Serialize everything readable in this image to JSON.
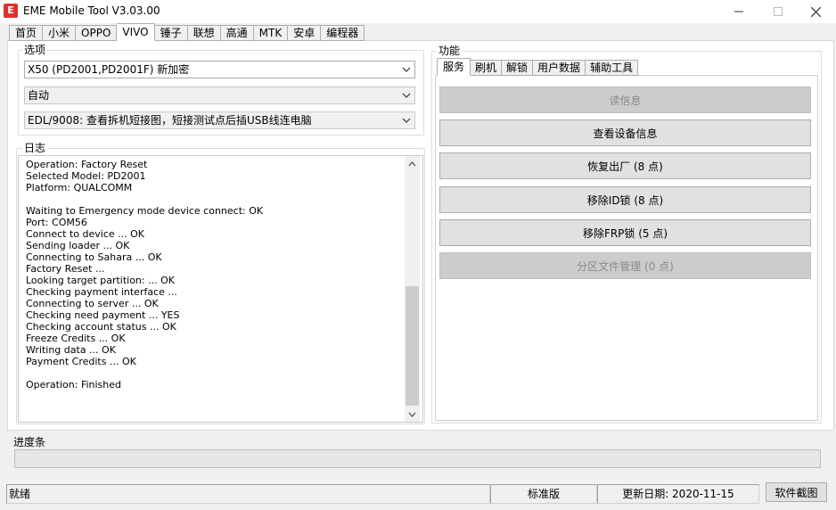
{
  "window": {
    "logo_letter": "E",
    "title": "EME Mobile Tool V3.03.00"
  },
  "top_tabs": [
    "首页",
    "小米",
    "OPPO",
    "VIVO",
    "锤子",
    "联想",
    "高通",
    "MTK",
    "安卓",
    "编程器"
  ],
  "active_top_tab": "VIVO",
  "options": {
    "title": "选项",
    "model": "X50 (PD2001,PD2001F) 新加密",
    "mode": "自动",
    "connection": "EDL/9008: 查看拆机短接图，短接测试点后插USB线连电脑"
  },
  "log": {
    "title": "日志",
    "lines": [
      "Operation: Factory Reset",
      "Selected Model: PD2001",
      "Platform: QUALCOMM",
      "",
      "Waiting to Emergency mode device connect: OK",
      "Port: COM56",
      "Connect to device ... OK",
      "Sending loader ... OK",
      "Connecting to Sahara ... OK",
      "Factory Reset ...",
      "Looking target partition: ... OK",
      "Checking payment interface ...",
      "Connecting to server ... OK",
      "Checking need payment ... YES",
      "Checking account status ... OK",
      "Freeze Credits ... OK",
      "Writing data ... OK",
      "Payment Credits ... OK",
      "",
      "Operation: Finished"
    ]
  },
  "functions": {
    "title": "功能",
    "tabs": [
      "服务",
      "刷机",
      "解锁",
      "用户数据",
      "辅助工具"
    ],
    "active_tab": "服务",
    "buttons": {
      "read_info": "读信息",
      "view_device_info": "查看设备信息",
      "factory_reset": "恢复出厂 (8 点)",
      "remove_id_lock": "移除ID锁 (8 点)",
      "remove_frp_lock": "移除FRP锁 (5 点)",
      "partition_manager": "分区文件管理 (0 点)"
    }
  },
  "progress": {
    "label": "进度条",
    "value": 0
  },
  "status": {
    "state": "就绪",
    "edition": "标准版",
    "update_date": "更新日期: 2020-11-15",
    "screenshot_button": "软件截图"
  }
}
